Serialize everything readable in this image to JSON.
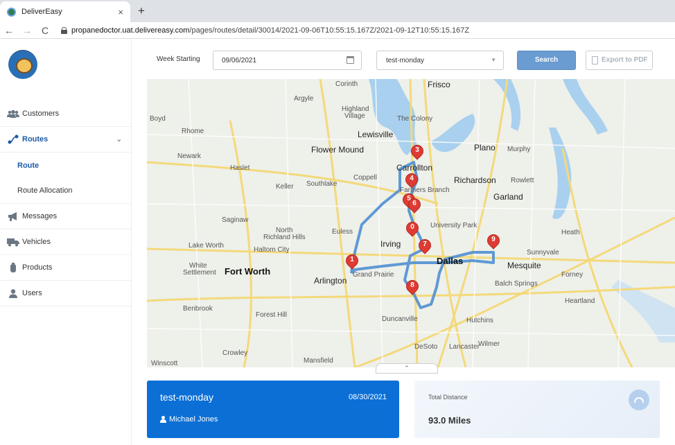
{
  "browser": {
    "tab_title": "DeliverEasy",
    "tab_close": "×",
    "new_tab": "+",
    "back": "←",
    "forward": "→",
    "reload": "C",
    "url_host": "propanedoctor.uat.delivereasy.com",
    "url_path": "/pages/routes/detail/30014/2021-09-06T10:55:15.167Z/2021-09-12T10:55:15.167Z"
  },
  "sidebar": {
    "items": [
      {
        "label": "Customers",
        "icon": "users-icon"
      },
      {
        "label": "Routes",
        "icon": "route-icon",
        "chevron": "⌄"
      },
      {
        "label": "Route"
      },
      {
        "label": "Route Allocation"
      },
      {
        "label": "Messages",
        "icon": "megaphone-icon"
      },
      {
        "label": "Vehicles",
        "icon": "truck-icon"
      },
      {
        "label": "Products",
        "icon": "propane-tank-icon"
      },
      {
        "label": "Users",
        "icon": "user-icon"
      }
    ]
  },
  "toolbar": {
    "week_label": "Week Starting",
    "week_value": "09/06/2021",
    "route_select": "test-monday",
    "search_label": "Search",
    "export_label": "Export to PDF"
  },
  "map": {
    "collapse": "⌃",
    "labels": {
      "corinth": "Corinth",
      "frisco": "Frisco",
      "argyle": "Argyle",
      "highland_village": "Highland",
      "village": "Village",
      "the_colony": "The Colony",
      "lewisville": "Lewisville",
      "plano": "Plano",
      "murphy": "Murphy",
      "boyd": "Boyd",
      "rhome": "Rhome",
      "newark": "Newark",
      "flower_mound": "Flower Mound",
      "haslet": "Haslet",
      "coppell": "Coppell",
      "carrollton": "Carrollton",
      "richardson": "Richardson",
      "rowlett": "Rowlett",
      "garland": "Garland",
      "keller": "Keller",
      "southlake": "Southlake",
      "farmers_branch": "Farmers Branch",
      "saginaw": "Saginaw",
      "north": "North",
      "richland_hills": "Richland Hills",
      "euless": "Euless",
      "irving": "Irving",
      "university_park": "University Park",
      "heath": "Heath",
      "lake_worth": "Lake Worth",
      "haltom_city": "Haltom City",
      "sunnyvale": "Sunnyvale",
      "white": "White",
      "settlement": "Settlement",
      "fort_worth": "Fort Worth",
      "dallas": "Dallas",
      "mesquite": "Mesquite",
      "arlington": "Arlington",
      "grand_prairie": "Grand Prairie",
      "forney": "Forney",
      "balch_springs": "Balch Springs",
      "benbrook": "Benbrook",
      "forest_hill": "Forest Hill",
      "heartland": "Heartland",
      "hutchins": "Hutchins",
      "duncanville": "Duncanville",
      "desoto": "DeSoto",
      "lancaster": "Lancaster",
      "wilmer": "Wilmer",
      "crowley": "Crowley",
      "mansfield": "Mansfield",
      "winscott": "Winscott"
    },
    "stops": [
      "3",
      "4",
      "5",
      "6",
      "0",
      "7",
      "1",
      "9",
      "8"
    ]
  },
  "route_card": {
    "name": "test-monday",
    "date": "08/30/2021",
    "driver": "Michael Jones"
  },
  "distance_card": {
    "label": "Total Distance",
    "value": "93.0 Miles"
  },
  "colors": {
    "accent": "#0b6fd6",
    "route_line": "#4f8fd1",
    "pin": "#df3b33"
  }
}
